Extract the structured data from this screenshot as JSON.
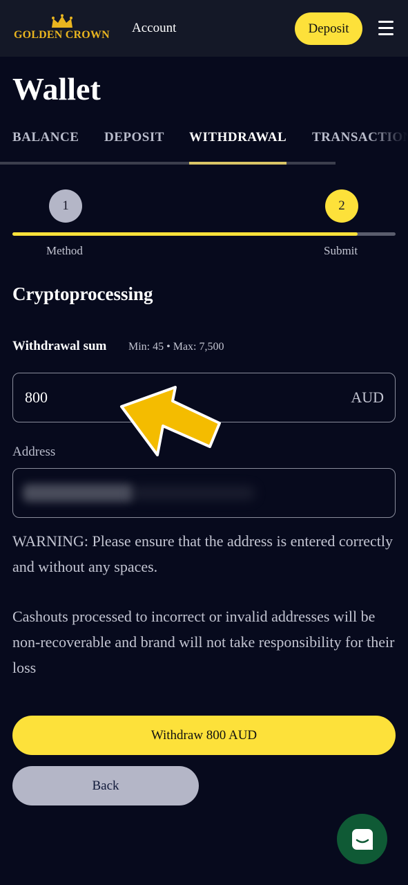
{
  "header": {
    "logo_text": "GOLDEN CROWN",
    "account_label": "Account",
    "deposit_label": "Deposit"
  },
  "page": {
    "title": "Wallet"
  },
  "tabs": [
    {
      "label": "BALANCE",
      "active": false
    },
    {
      "label": "DEPOSIT",
      "active": false
    },
    {
      "label": "WITHDRAWAL",
      "active": true
    },
    {
      "label": "TRANSACTIONS",
      "active": false
    }
  ],
  "stepper": {
    "steps": [
      {
        "number": "1",
        "label": "Method"
      },
      {
        "number": "2",
        "label": "Submit"
      }
    ],
    "progress_percent": 90
  },
  "form": {
    "section_title": "Cryptoprocessing",
    "sum_label": "Withdrawal sum",
    "sum_limits": "Min: 45 • Max: 7,500",
    "amount_value": "800",
    "currency": "AUD",
    "address_label": "Address"
  },
  "messages": {
    "warning": "WARNING: Please ensure that the address is entered correctly and without any spaces.",
    "notice": "Cashouts processed to incorrect or invalid addresses will be non-recoverable and brand will not take responsibility for their loss"
  },
  "buttons": {
    "withdraw_label": "Withdraw 800 AUD",
    "back_label": "Back"
  },
  "colors": {
    "accent": "#fde13a",
    "background": "#070a1d",
    "header": "#141827",
    "chat": "#0f5a35"
  }
}
